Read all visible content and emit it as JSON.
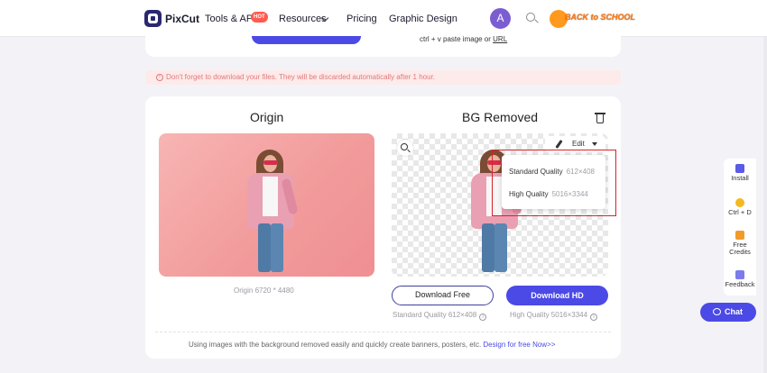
{
  "nav": {
    "brand": "PixCut",
    "tools_api": "Tools & API",
    "hot_badge": "HOT",
    "resources": "Resources",
    "pricing": "Pricing",
    "graphic_design": "Graphic Design",
    "avatar_letter": "A",
    "promo_text": "BACK to SCHOOL"
  },
  "upload": {
    "paste_hint_prefix": "ctrl + v paste image or ",
    "paste_hint_url": "URL"
  },
  "notice": {
    "icon": "!",
    "text": "Don't forget to download your files. They will be discarded automatically after 1 hour."
  },
  "result": {
    "origin_title": "Origin",
    "removed_title": "BG Removed",
    "origin_caption": "Origin 6720 * 4480",
    "edit_label": "Edit",
    "dropdown": [
      {
        "label": "Standard Quality",
        "size": "612×408"
      },
      {
        "label": "High Quality",
        "size": "5016×3344"
      }
    ],
    "download_free": "Download Free",
    "download_hd": "Download HD",
    "free_caption": "Standard Quality 612×408",
    "hd_caption": "High Quality 5016×3344",
    "info_glyph": "i",
    "footer_text": "Using images with the background removed easily and quickly create banners, posters, etc. ",
    "footer_link": "Design for free Now>>"
  },
  "sidebar": {
    "install": "Install",
    "bookmark": "Ctrl + D",
    "free_credits_1": "Free",
    "free_credits_2": "Credits",
    "feedback": "Feedback",
    "chat": "Chat"
  },
  "colors": {
    "accent": "#4b4ae6",
    "notice_text": "#e07a7a",
    "highlight_border": "#d8232a"
  }
}
